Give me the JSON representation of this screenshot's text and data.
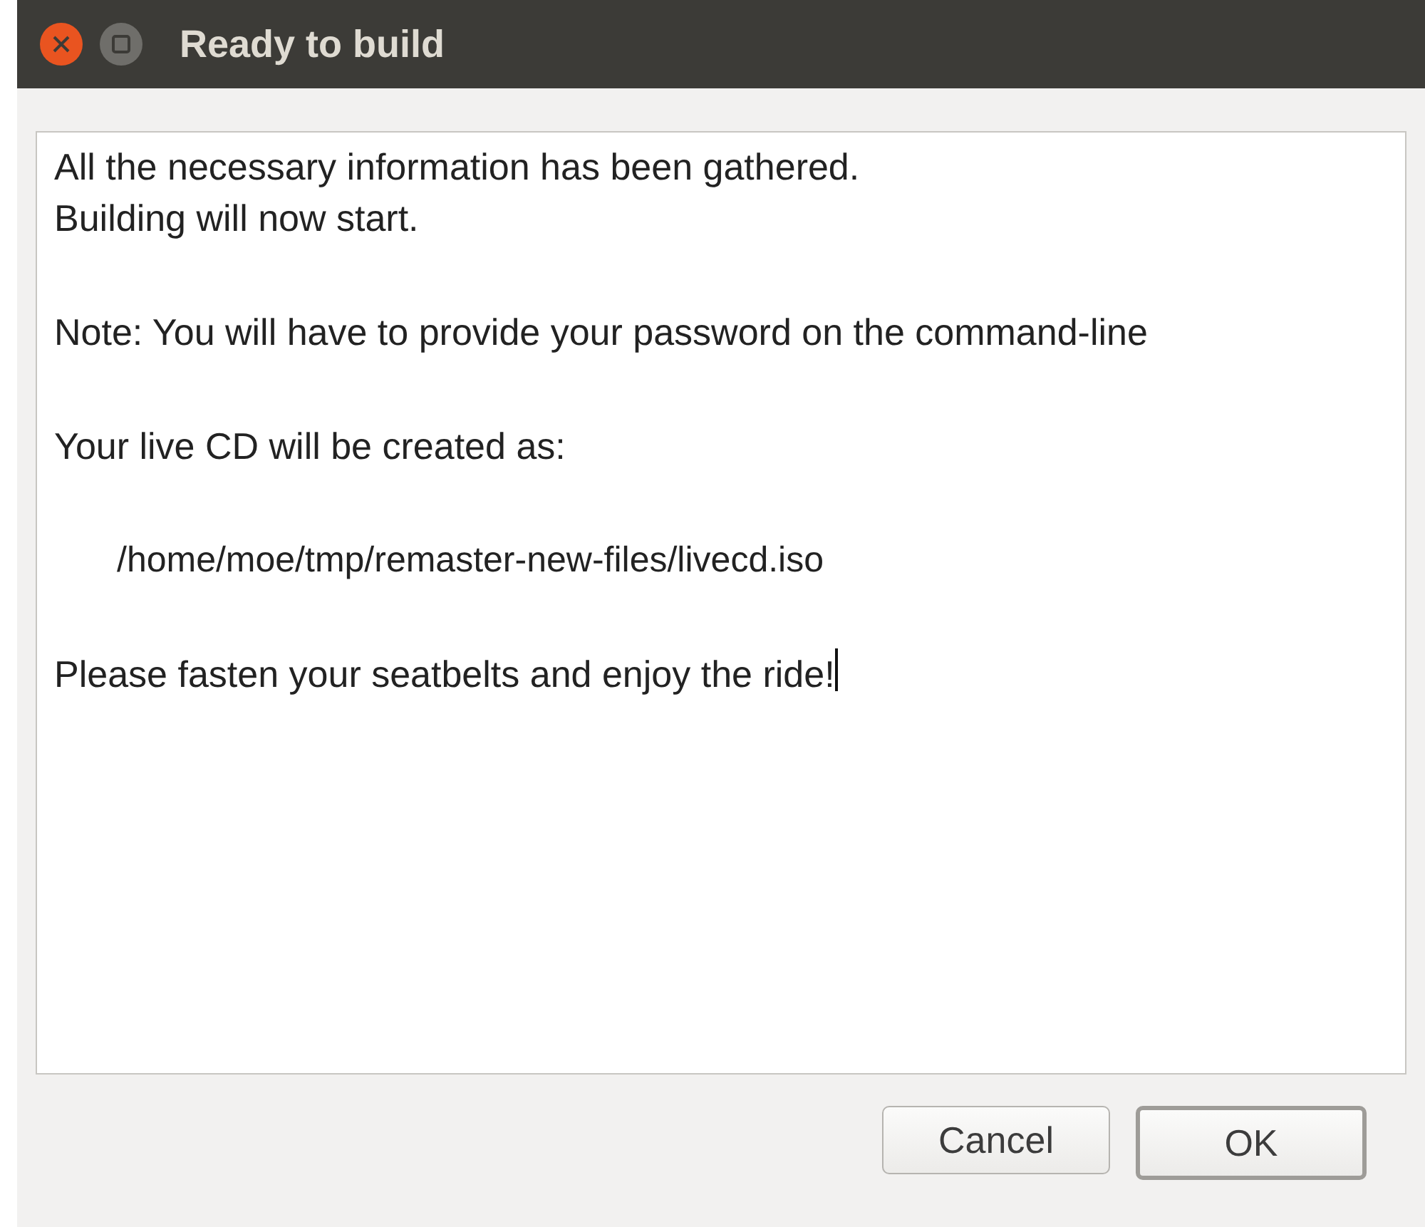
{
  "window": {
    "title": "Ready to build"
  },
  "message": {
    "paragraphs": [
      {
        "kind": "text",
        "lines": [
          "All the necessary information has been gathered.",
          "Building will now start."
        ]
      },
      {
        "kind": "text",
        "lines": [
          "Note: You will have to provide your password on the command-line"
        ]
      },
      {
        "kind": "text",
        "lines": [
          "Your live CD will be created as:"
        ]
      },
      {
        "kind": "path",
        "lines": [
          "/home/moe/tmp/remaster-new-files/livecd.iso"
        ]
      },
      {
        "kind": "text",
        "lines": [
          "Please fasten your seatbelts and enjoy the ride!"
        ]
      }
    ]
  },
  "buttons": [
    {
      "label": "Cancel",
      "default": false
    },
    {
      "label": "OK",
      "default": true
    }
  ]
}
